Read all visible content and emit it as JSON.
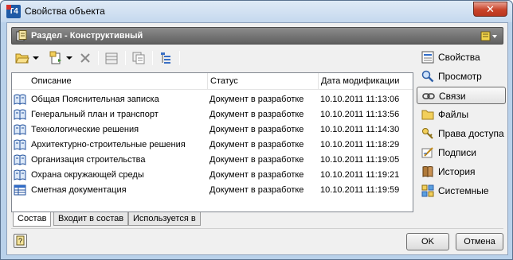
{
  "window": {
    "title": "Свойства объекта",
    "app_icon_label": "T4",
    "close_glyph": "✕"
  },
  "section": {
    "title": "Раздел - Конструктивный"
  },
  "toolbar": {
    "icons": [
      "folder-open-icon",
      "dropdown-arrow-icon",
      "new-document-icon",
      "dropdown-arrow-icon",
      "delete-icon",
      "table-icon",
      "copy-icon",
      "hierarchy-icon"
    ]
  },
  "list": {
    "columns": [
      "Описание",
      "Статус",
      "Дата модификации"
    ],
    "rows": [
      {
        "icon": "book-icon",
        "name": "Общая Пояснительная записка",
        "status": "Документ в разработке",
        "date": "10.10.2011 11:13:06"
      },
      {
        "icon": "book-icon",
        "name": "Генеральный план и транспорт",
        "status": "Документ в разработке",
        "date": "10.10.2011 11:13:56"
      },
      {
        "icon": "book-icon",
        "name": "Технологические решения",
        "status": "Документ в разработке",
        "date": "10.10.2011 11:14:30"
      },
      {
        "icon": "book-icon",
        "name": "Архитектурно-строительные решения",
        "status": "Документ в разработке",
        "date": "10.10.2011 11:18:29"
      },
      {
        "icon": "book-icon",
        "name": "Организация строительства",
        "status": "Документ в разработке",
        "date": "10.10.2011 11:19:05"
      },
      {
        "icon": "book-icon",
        "name": "Охрана окружающей среды",
        "status": "Документ в разработке",
        "date": "10.10.2011 11:19:21"
      },
      {
        "icon": "spreadsheet-icon",
        "name": "Сметная документация",
        "status": "Документ в разработке",
        "date": "10.10.2011 11:19:59"
      }
    ]
  },
  "tabs": [
    "Состав",
    "Входит в состав",
    "Используется в"
  ],
  "side": {
    "items": [
      {
        "label": "Свойства",
        "icon": "properties-icon"
      },
      {
        "label": "Просмотр",
        "icon": "magnifier-icon"
      },
      {
        "label": "Связи",
        "icon": "link-icon"
      },
      {
        "label": "Файлы",
        "icon": "files-icon"
      },
      {
        "label": "Права доступа",
        "icon": "key-icon"
      },
      {
        "label": "Подписи",
        "icon": "signature-icon"
      },
      {
        "label": "История",
        "icon": "history-icon"
      },
      {
        "label": "Системные",
        "icon": "system-icon"
      }
    ]
  },
  "buttons": {
    "ok": "OK",
    "cancel": "Отмена"
  }
}
